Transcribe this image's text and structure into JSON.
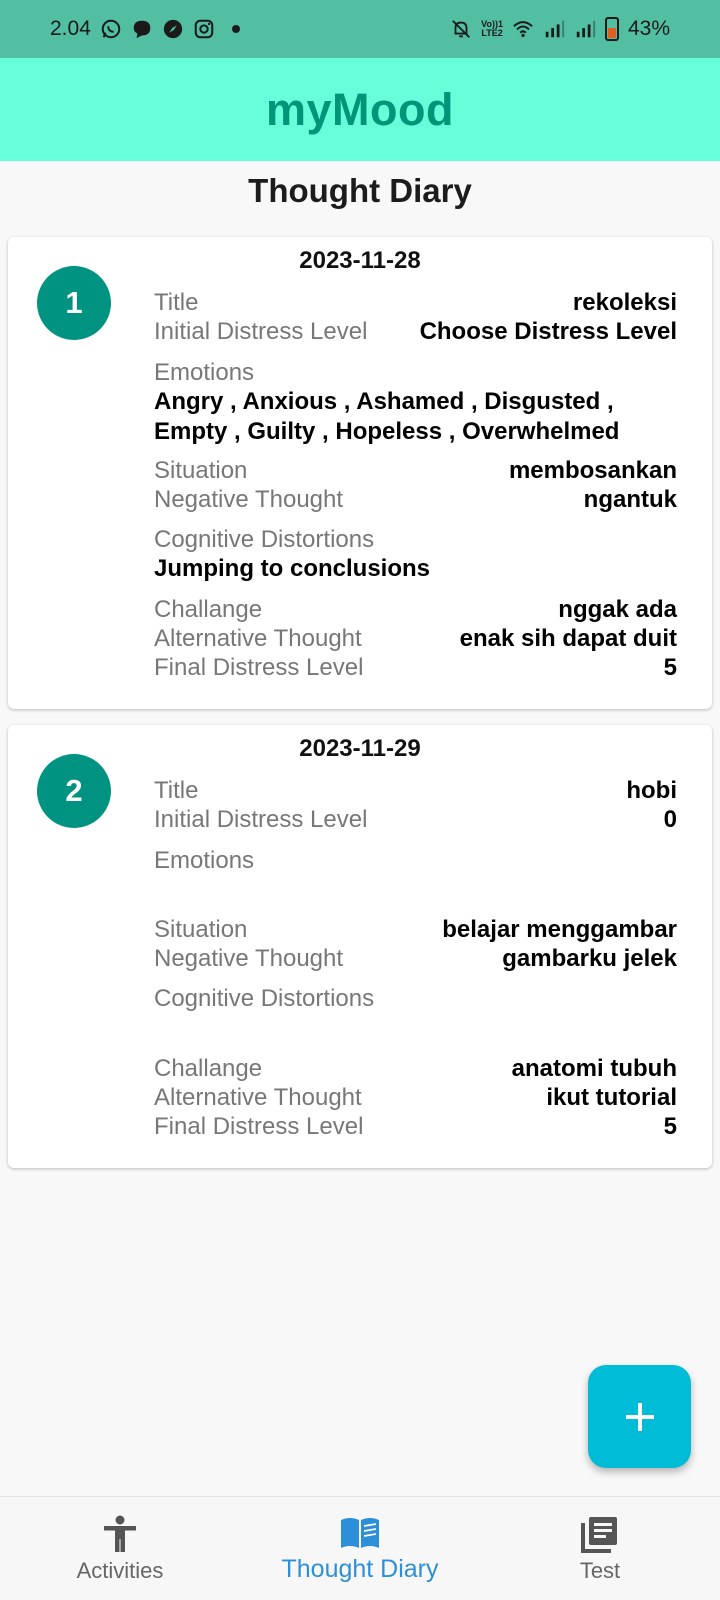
{
  "status_bar": {
    "time": "2.04",
    "network_label_top": "Vo))1",
    "network_label_bottom": "LTE2",
    "battery_percent": "43%"
  },
  "app_bar": {
    "title": "myMood"
  },
  "page": {
    "title": "Thought Diary"
  },
  "entries": [
    {
      "number": "1",
      "date": "2023-11-28",
      "title_label": "Title",
      "title_value": "rekoleksi",
      "initial_label": "Initial Distress Level",
      "initial_value": "Choose Distress Level",
      "emotions_label": "Emotions",
      "emotions_value": "Angry , Anxious , Ashamed , Disgusted , Empty , Guilty , Hopeless , Overwhelmed",
      "situation_label": "Situation",
      "situation_value": "membosankan",
      "negative_label": "Negative Thought",
      "negative_value": "ngantuk",
      "distortions_label": "Cognitive Distortions",
      "distortions_value": "Jumping to conclusions",
      "challange_label": "Challange",
      "challange_value": "nggak ada",
      "alternative_label": "Alternative Thought",
      "alternative_value": "enak sih dapat duit",
      "final_label": "Final Distress Level",
      "final_value": "5"
    },
    {
      "number": "2",
      "date": "2023-11-29",
      "title_label": "Title",
      "title_value": "hobi",
      "initial_label": "Initial Distress Level",
      "initial_value": "0",
      "emotions_label": "Emotions",
      "emotions_value": "",
      "situation_label": "Situation",
      "situation_value": "belajar menggambar",
      "negative_label": "Negative Thought",
      "negative_value": "gambarku jelek",
      "distortions_label": "Cognitive Distortions",
      "distortions_value": "",
      "challange_label": "Challange",
      "challange_value": "anatomi tubuh",
      "alternative_label": "Alternative Thought",
      "alternative_value": "ikut tutorial",
      "final_label": "Final Distress Level",
      "final_value": "5"
    }
  ],
  "fab": {
    "icon": "plus-icon",
    "color": "#00bcd6"
  },
  "bottom_nav": [
    {
      "label": "Activities",
      "icon": "accessibility-person-icon"
    },
    {
      "label": "Thought Diary",
      "icon": "open-book-icon",
      "active": true
    },
    {
      "label": "Test",
      "icon": "library-books-icon"
    }
  ],
  "colors": {
    "status_bar": "#52bfa2",
    "app_bar": "#67ffd9",
    "app_title": "#009578",
    "badge": "#009381",
    "active_nav": "#2d8fd8"
  }
}
